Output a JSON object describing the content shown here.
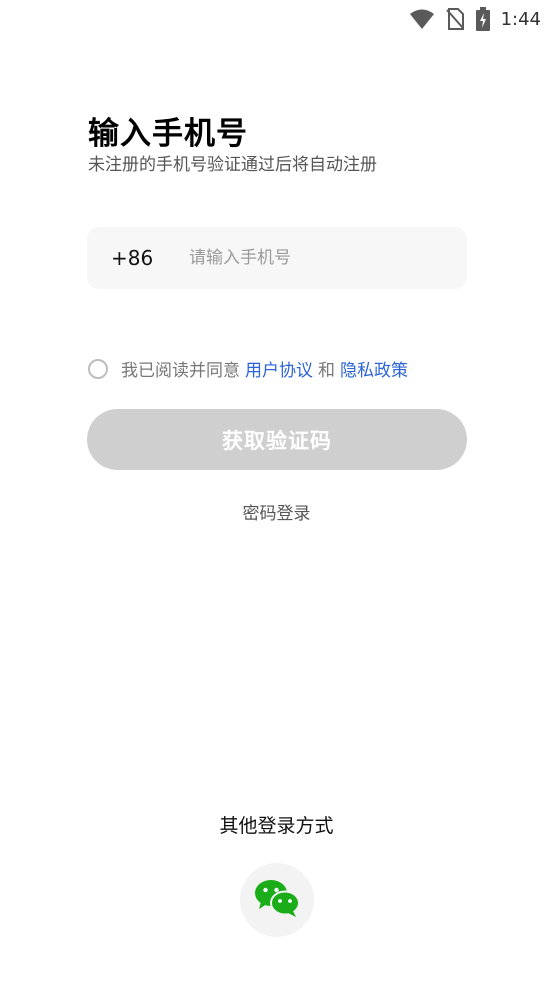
{
  "status_bar": {
    "time": "1:44",
    "icons": [
      "wifi-icon",
      "no-sim-icon",
      "battery-charging-icon"
    ]
  },
  "header": {
    "title": "输入手机号",
    "subtitle": "未注册的手机号验证通过后将自动注册"
  },
  "phone": {
    "country_code": "+86",
    "placeholder": "请输入手机号",
    "value": ""
  },
  "agreement": {
    "prefix": "我已阅读并同意",
    "user_agreement": "用户协议",
    "and": "和",
    "privacy_policy": "隐私政策",
    "checked": false,
    "link_color": "#2b63d8"
  },
  "actions": {
    "get_code_label": "获取验证码",
    "get_code_enabled": false,
    "password_login_label": "密码登录"
  },
  "other_login": {
    "title": "其他登录方式",
    "methods": [
      "wechat-icon"
    ],
    "wechat_color": "#1aad19"
  }
}
